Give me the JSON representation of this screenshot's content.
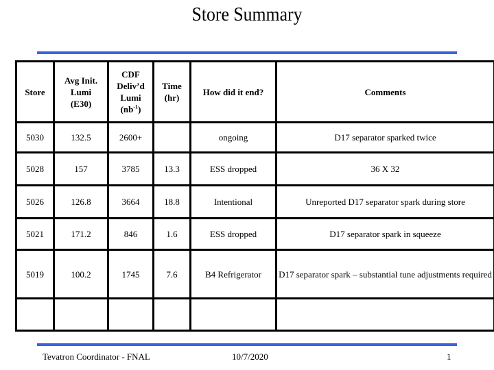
{
  "slide": {
    "title": "Store Summary",
    "accent_color": "#3b63db"
  },
  "table": {
    "headers": {
      "store": "Store",
      "avg_init_lumi": [
        "Avg Init.",
        "Lumi",
        "(E30)"
      ],
      "cdf_lumi": [
        "CDF",
        "Deliv’d",
        "Lumi",
        "(nb",
        "-1",
        ")"
      ],
      "time": [
        "Time",
        "(hr)"
      ],
      "how_end": "How did it end?",
      "comments": "Comments"
    },
    "rows": [
      {
        "store": "5030",
        "avg": "132.5",
        "cdf": "2600+",
        "time": "",
        "end": "ongoing",
        "comment": "D17 separator sparked twice"
      },
      {
        "store": "5028",
        "avg": "157",
        "cdf": "3785",
        "time": "13.3",
        "end": "ESS dropped",
        "comment": "36 X 32"
      },
      {
        "store": "5026",
        "avg": "126.8",
        "cdf": "3664",
        "time": "18.8",
        "end": "Intentional",
        "comment": "Unreported D17 separator spark during store"
      },
      {
        "store": "5021",
        "avg": "171.2",
        "cdf": "846",
        "time": "1.6",
        "end": "ESS dropped",
        "comment": "D17 separator spark in squeeze"
      },
      {
        "store": "5019",
        "avg": "100.2",
        "cdf": "1745",
        "time": "7.6",
        "end": "B4 Refrigerator",
        "comment": "D17 separator spark – substantial tune adjustments required"
      },
      {
        "store": "",
        "avg": "",
        "cdf": "",
        "time": "",
        "end": "",
        "comment": ""
      }
    ]
  },
  "footer": {
    "organization": "Tevatron Coordinator - FNAL",
    "date": "10/7/2020",
    "page_number": "1"
  }
}
